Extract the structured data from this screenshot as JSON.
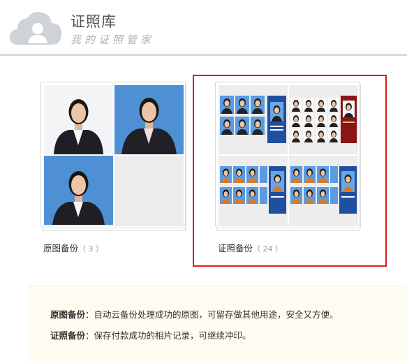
{
  "header": {
    "title": "证照库",
    "subtitle": "我的证照管家"
  },
  "albums": [
    {
      "label": "原图备份",
      "count": "（ 3 ）"
    },
    {
      "label": "证照备份",
      "count": "（ 24 ）"
    }
  ],
  "notice": {
    "line1_term": "原图备份",
    "line1_text": "：自动云备份处理成功的原图，可留存做其他用途，安全又方便。",
    "line2_term": "证照备份",
    "line2_text": "：保存付款成功的相片记录，可继续冲印。"
  },
  "colors": {
    "highlight_border": "#e01d1d",
    "photo_blue_bg": "#4f8fd3",
    "notice_bg": "#fefcf0"
  }
}
